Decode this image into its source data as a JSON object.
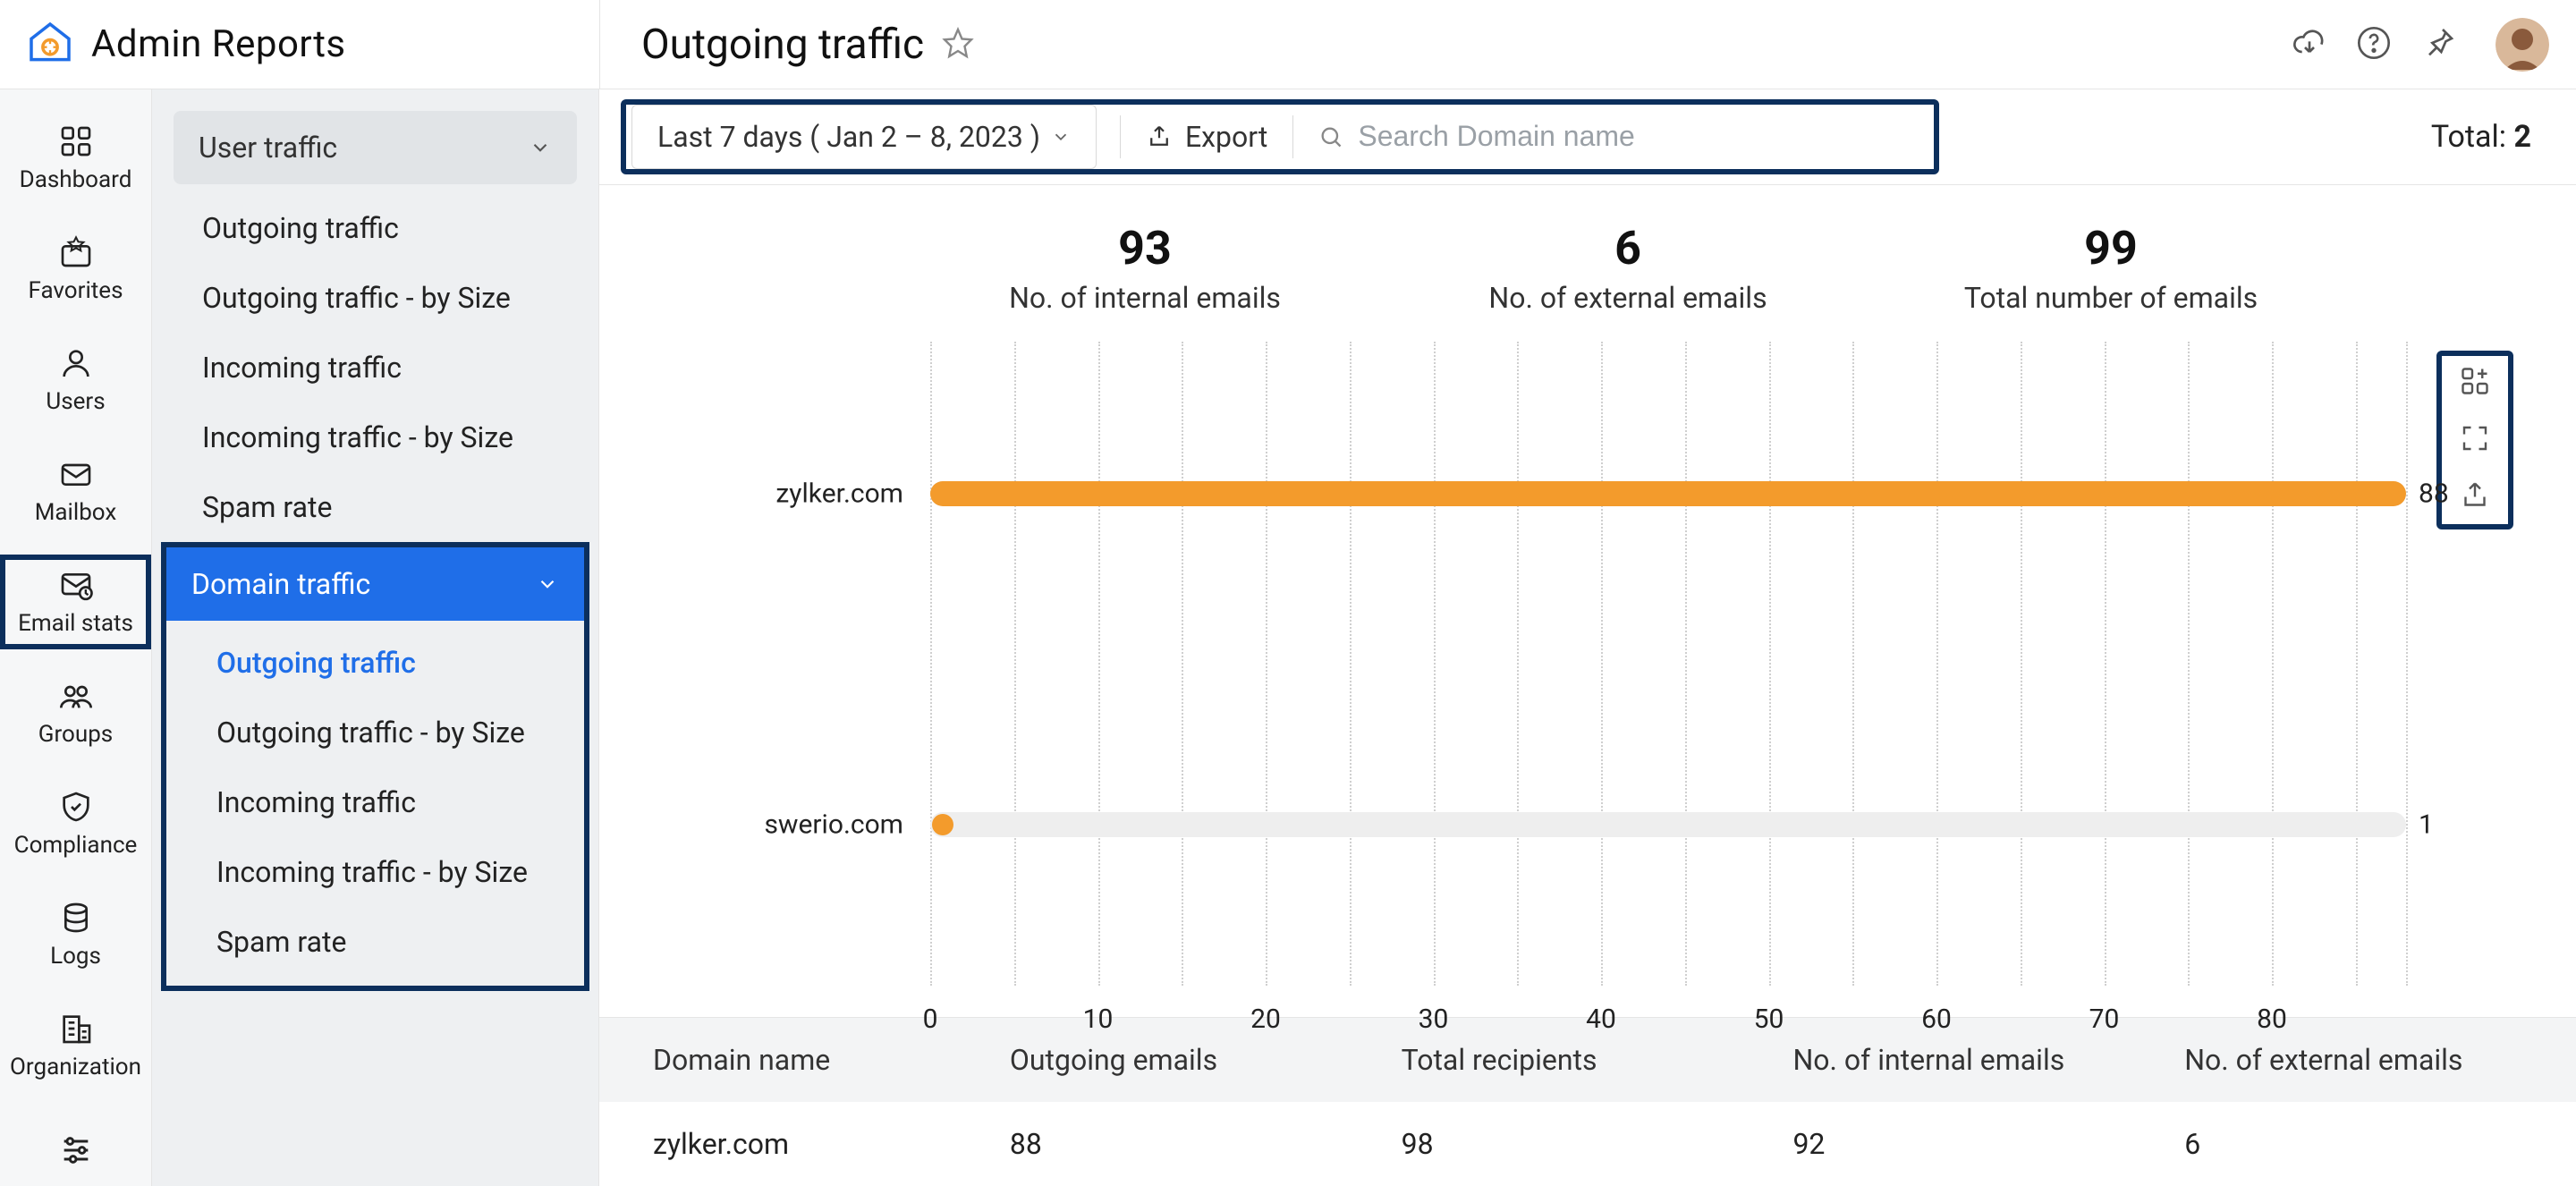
{
  "app_title": "Admin Reports",
  "page_title": "Outgoing traffic",
  "nav_rail": [
    {
      "label": "Dashboard"
    },
    {
      "label": "Favorites"
    },
    {
      "label": "Users"
    },
    {
      "label": "Mailbox"
    },
    {
      "label": "Email stats"
    },
    {
      "label": "Groups"
    },
    {
      "label": "Compliance"
    },
    {
      "label": "Logs"
    },
    {
      "label": "Organization"
    }
  ],
  "sidebar": {
    "user_traffic": {
      "header": "User traffic",
      "items": [
        "Outgoing traffic",
        "Outgoing traffic - by Size",
        "Incoming traffic",
        "Incoming traffic - by Size",
        "Spam rate"
      ]
    },
    "domain_traffic": {
      "header": "Domain traffic",
      "items": [
        "Outgoing traffic",
        "Outgoing traffic - by Size",
        "Incoming traffic",
        "Incoming traffic - by Size",
        "Spam rate"
      ]
    }
  },
  "toolbar": {
    "date_range": "Last 7 days ( Jan 2 – 8, 2023 )",
    "export_label": "Export",
    "search_placeholder": "Search Domain name",
    "total_label": "Total:",
    "total_value": "2"
  },
  "stats": [
    {
      "value": "93",
      "label": "No. of internal emails"
    },
    {
      "value": "6",
      "label": "No. of external emails"
    },
    {
      "value": "99",
      "label": "Total number of emails"
    }
  ],
  "chart_data": {
    "type": "bar",
    "orientation": "horizontal",
    "xlabel": "",
    "ylabel": "",
    "xlim": [
      0,
      88
    ],
    "x_ticks": [
      0,
      10,
      20,
      30,
      40,
      50,
      60,
      70,
      80
    ],
    "categories": [
      "zylker.com",
      "swerio.com"
    ],
    "values": [
      88,
      1
    ],
    "bar_color": "#f39b2c"
  },
  "table": {
    "columns": [
      "Domain name",
      "Outgoing emails",
      "Total recipients",
      "No. of internal emails",
      "No. of external emails"
    ],
    "rows": [
      {
        "domain": "zylker.com",
        "outgoing": "88",
        "recipients": "98",
        "internal": "92",
        "external": "6"
      }
    ]
  }
}
